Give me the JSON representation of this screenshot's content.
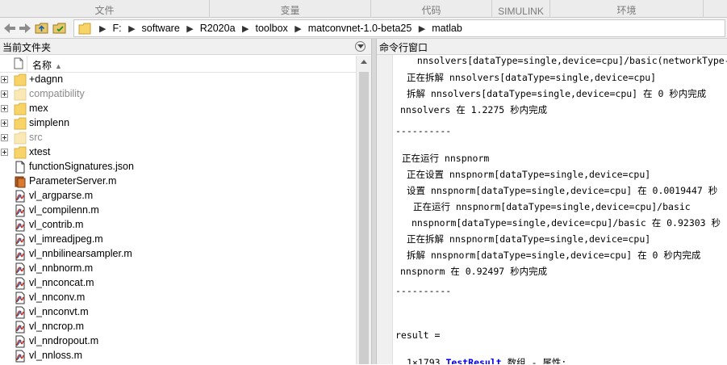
{
  "toolstrip": {
    "tabs": [
      {
        "label": "文件"
      },
      {
        "label": "变量"
      },
      {
        "label": "代码"
      },
      {
        "label": "SIMULINK"
      },
      {
        "label": "环境"
      }
    ]
  },
  "address": {
    "segments": [
      "F:",
      "software",
      "R2020a",
      "toolbox",
      "matconvnet-1.0-beta25",
      "matlab"
    ]
  },
  "current_folder": {
    "title": "当前文件夹",
    "column_name": "名称",
    "items": [
      {
        "name": "+dagnn",
        "type": "folder",
        "expandable": true,
        "dim": false
      },
      {
        "name": "compatibility",
        "type": "folder-dim",
        "expandable": true,
        "dim": true
      },
      {
        "name": "mex",
        "type": "folder",
        "expandable": true,
        "dim": false
      },
      {
        "name": "simplenn",
        "type": "folder",
        "expandable": true,
        "dim": false
      },
      {
        "name": "src",
        "type": "folder-dim",
        "expandable": true,
        "dim": true
      },
      {
        "name": "xtest",
        "type": "folder",
        "expandable": true,
        "dim": false
      },
      {
        "name": "functionSignatures.json",
        "type": "json",
        "expandable": false,
        "dim": false
      },
      {
        "name": "ParameterServer.m",
        "type": "class",
        "expandable": false,
        "dim": false
      },
      {
        "name": "vl_argparse.m",
        "type": "mfile",
        "expandable": false,
        "dim": false
      },
      {
        "name": "vl_compilenn.m",
        "type": "mfile",
        "expandable": false,
        "dim": false
      },
      {
        "name": "vl_contrib.m",
        "type": "mfile",
        "expandable": false,
        "dim": false
      },
      {
        "name": "vl_imreadjpeg.m",
        "type": "mfile",
        "expandable": false,
        "dim": false
      },
      {
        "name": "vl_nnbilinearsampler.m",
        "type": "mfile",
        "expandable": false,
        "dim": false
      },
      {
        "name": "vl_nnbnorm.m",
        "type": "mfile",
        "expandable": false,
        "dim": false
      },
      {
        "name": "vl_nnconcat.m",
        "type": "mfile",
        "expandable": false,
        "dim": false
      },
      {
        "name": "vl_nnconv.m",
        "type": "mfile",
        "expandable": false,
        "dim": false
      },
      {
        "name": "vl_nnconvt.m",
        "type": "mfile",
        "expandable": false,
        "dim": false
      },
      {
        "name": "vl_nncrop.m",
        "type": "mfile",
        "expandable": false,
        "dim": false
      },
      {
        "name": "vl_nndropout.m",
        "type": "mfile",
        "expandable": false,
        "dim": false
      },
      {
        "name": "vl_nnloss.m",
        "type": "mfile",
        "expandable": false,
        "dim": false
      }
    ]
  },
  "command_window": {
    "title": "命令行窗口",
    "lines": [
      {
        "text": " nnsolvers[dataType=single,device=cpu]/basic(networkType-",
        "indent": 20
      },
      {
        "text": "正在拆解 nnsolvers[dataType=single,device=cpu]",
        "indent": 14
      },
      {
        "text": "拆解 nnsolvers[dataType=single,device=cpu] 在 0 秒内完成",
        "indent": 14
      },
      {
        "text": "nnsolvers 在 1.2275 秒内完成",
        "indent": 6
      },
      {
        "text": "----------",
        "indent": 0
      },
      {
        "text": "正在运行 nnspnorm",
        "indent": 8
      },
      {
        "text": "正在设置 nnspnorm[dataType=single,device=cpu]",
        "indent": 14
      },
      {
        "text": "设置 nnspnorm[dataType=single,device=cpu] 在 0.0019447 秒",
        "indent": 14
      },
      {
        "text": "正在运行 nnspnorm[dataType=single,device=cpu]/basic",
        "indent": 22
      },
      {
        "text": "nnspnorm[dataType=single,device=cpu]/basic 在 0.92303 秒",
        "indent": 20
      },
      {
        "text": "正在拆解 nnspnorm[dataType=single,device=cpu]",
        "indent": 14
      },
      {
        "text": "拆解 nnspnorm[dataType=single,device=cpu] 在 0 秒内完成",
        "indent": 14
      },
      {
        "text": "nnspnorm 在 0.92497 秒内完成",
        "indent": 6
      },
      {
        "text": "----------",
        "indent": 0
      },
      {
        "text": "result =",
        "indent": 0
      },
      {
        "text": "1×1793 ",
        "indent": 14,
        "link": "TestResult",
        "after": " 数组 - 属性:"
      }
    ]
  }
}
